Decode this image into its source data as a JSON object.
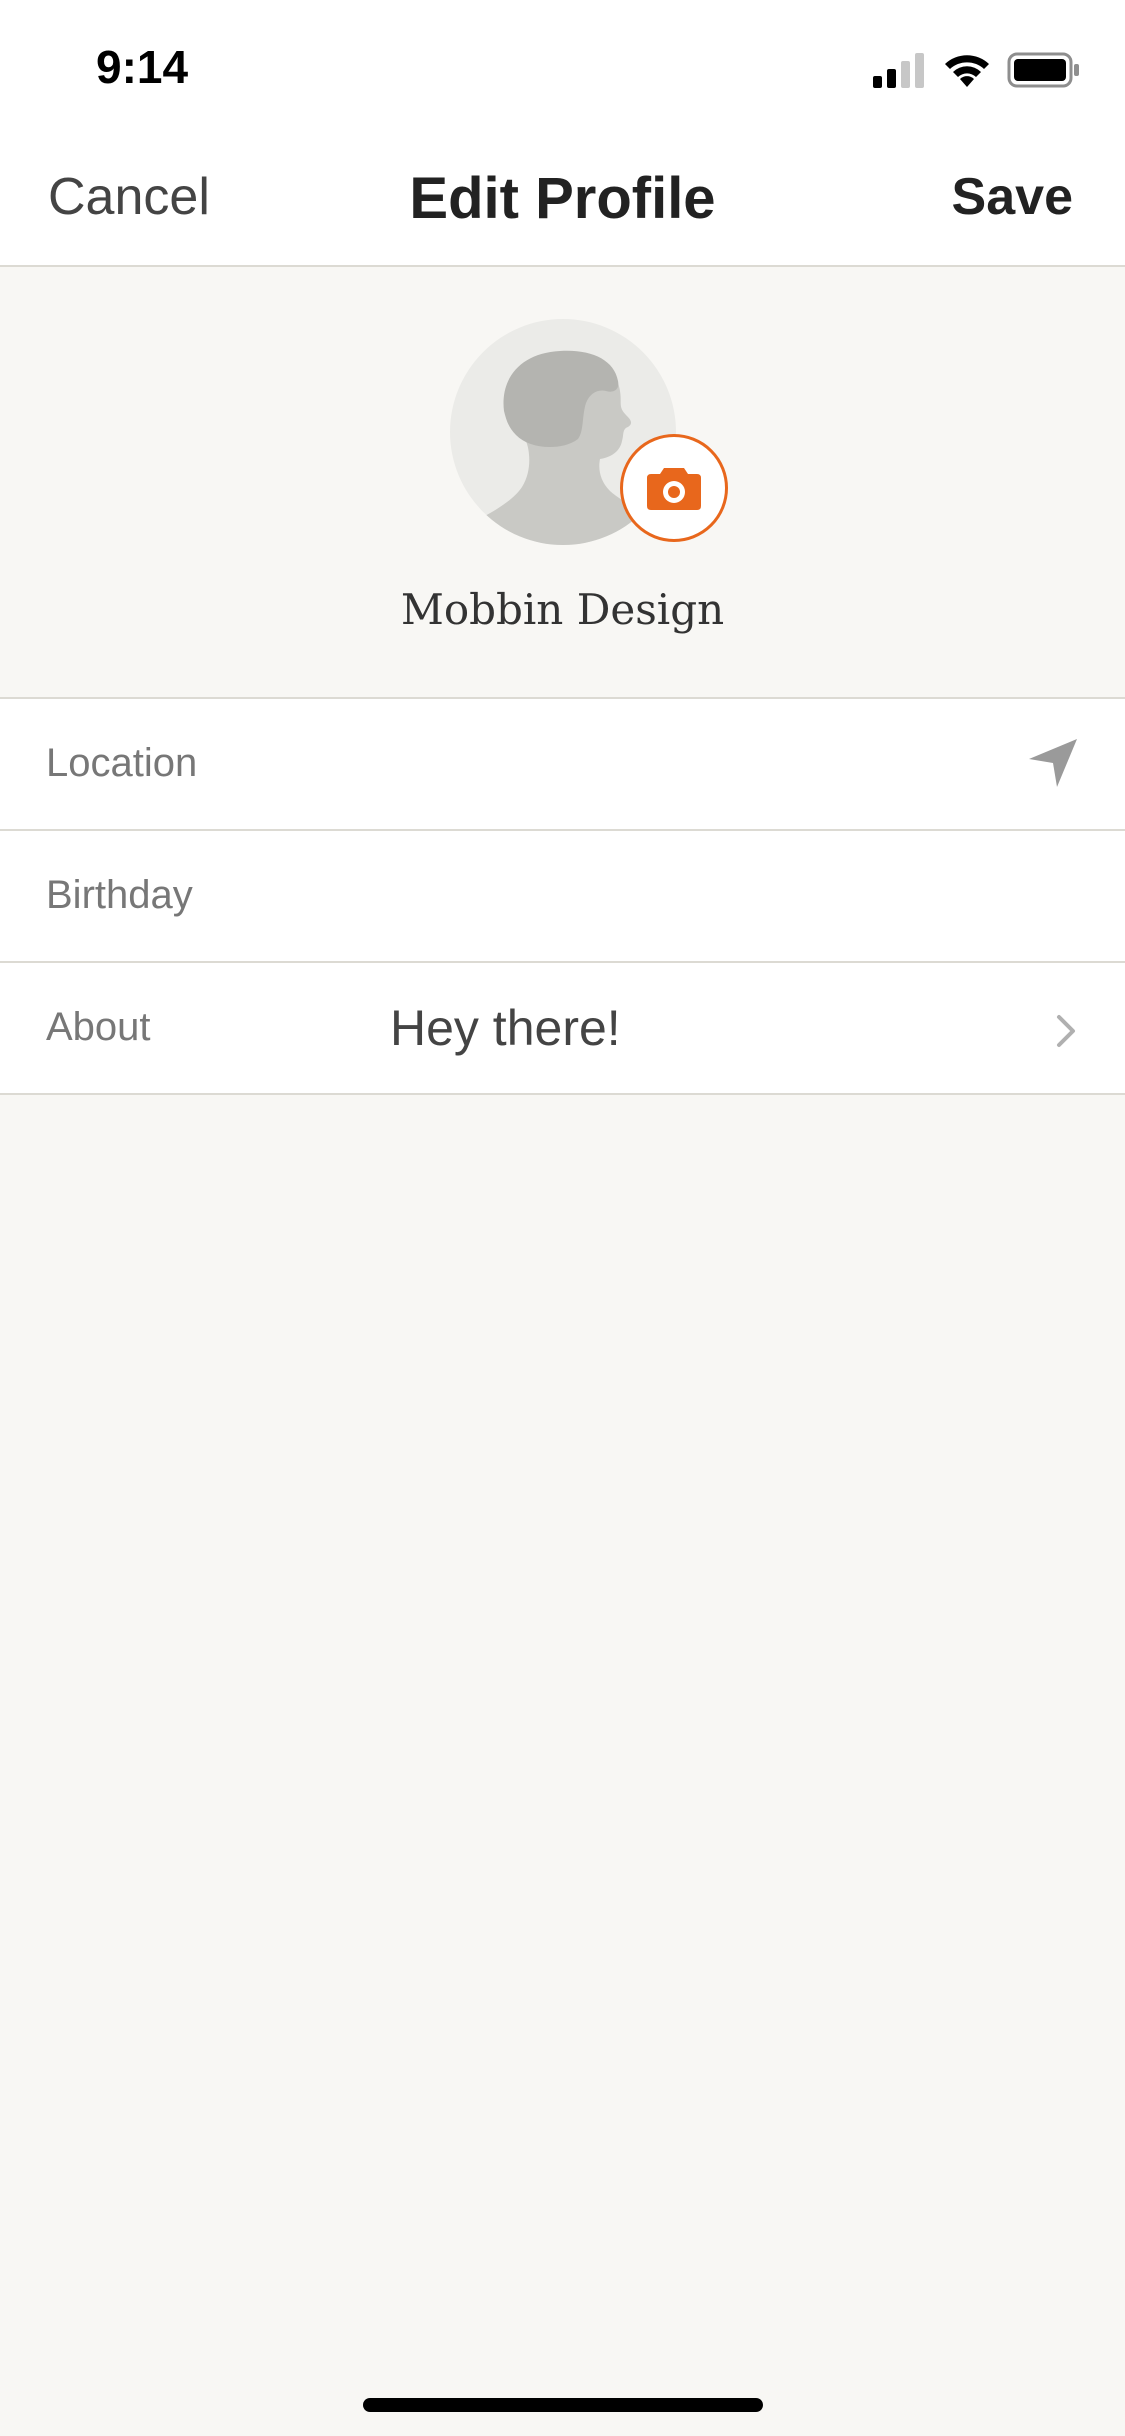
{
  "status_bar": {
    "time": "9:14",
    "icons": [
      "cellular-signal-icon",
      "wifi-icon",
      "battery-icon"
    ]
  },
  "nav": {
    "cancel_label": "Cancel",
    "title": "Edit Profile",
    "save_label": "Save"
  },
  "profile": {
    "name": "Mobbin Design",
    "avatar_icon": "silhouette-avatar-icon",
    "photo_button_icon": "camera-icon"
  },
  "fields": [
    {
      "label": "Location",
      "value": "",
      "icon": "location-arrow-icon"
    },
    {
      "label": "Birthday",
      "value": "",
      "icon": ""
    },
    {
      "label": "About",
      "value": "Hey there!",
      "icon": "chevron-right-icon"
    }
  ],
  "colors": {
    "accent": "#e8671c",
    "background": "#f8f7f4",
    "divider": "#dcdad3",
    "label": "#777777",
    "text": "#222222"
  }
}
